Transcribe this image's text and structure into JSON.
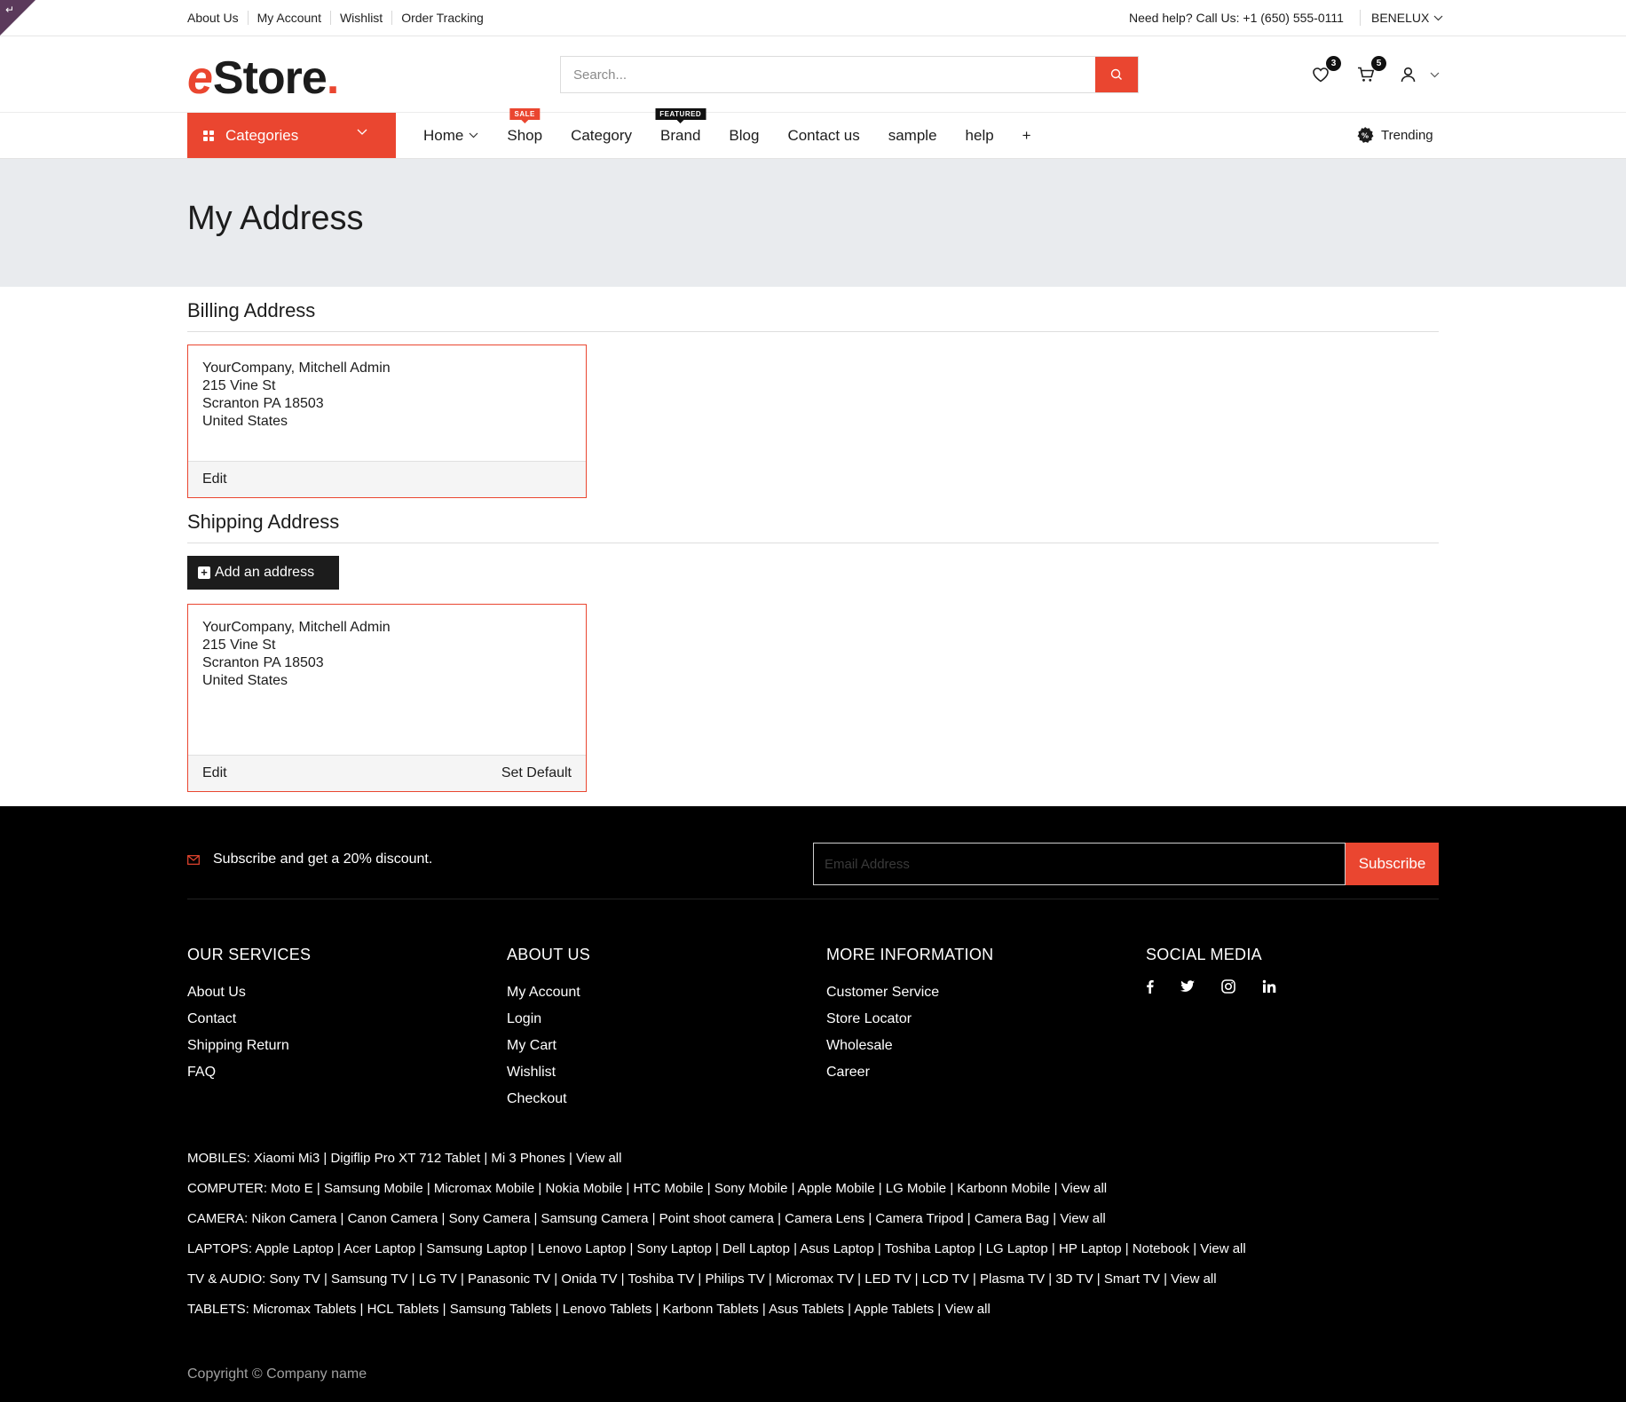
{
  "topbar": {
    "links": [
      "About Us",
      "My Account",
      "Wishlist",
      "Order Tracking"
    ],
    "help_text": "Need help? Call Us: +1 (650) 555-0111",
    "region": "BENELUX"
  },
  "header": {
    "logo_e": "e",
    "logo_rest": "Store",
    "logo_dot": ".",
    "search_placeholder": "Search...",
    "wishlist_count": "3",
    "cart_count": "5"
  },
  "nav": {
    "categories_label": "Categories",
    "items": [
      {
        "label": "Home"
      },
      {
        "label": "Shop",
        "tag": "SALE"
      },
      {
        "label": "Category"
      },
      {
        "label": "Brand",
        "tag": "FEATURED"
      },
      {
        "label": "Blog"
      },
      {
        "label": "Contact us"
      },
      {
        "label": "sample"
      },
      {
        "label": "help"
      },
      {
        "label": "+"
      }
    ],
    "trending_label": "Trending"
  },
  "page": {
    "title": "My Address",
    "billing_heading": "Billing Address",
    "shipping_heading": "Shipping Address",
    "add_address_label": "Add an address",
    "billing": {
      "lines": [
        "YourCompany, Mitchell Admin",
        "215 Vine St",
        "Scranton PA 18503",
        "United States"
      ],
      "edit_label": "Edit"
    },
    "shipping": {
      "lines": [
        "YourCompany, Mitchell Admin",
        "215 Vine St",
        "Scranton PA 18503",
        "United States"
      ],
      "edit_label": "Edit",
      "set_default_label": "Set Default"
    }
  },
  "footer": {
    "subscribe_text": "Subscribe and get a 20% discount.",
    "email_placeholder": "Email Address",
    "subscribe_button": "Subscribe",
    "columns": [
      {
        "title": "OUR SERVICES",
        "links": [
          "About Us",
          "Contact",
          "Shipping Return",
          "FAQ"
        ]
      },
      {
        "title": "ABOUT US",
        "links": [
          "My Account",
          "Login",
          "My Cart",
          "Wishlist",
          "Checkout"
        ]
      },
      {
        "title": "MORE INFORMATION",
        "links": [
          "Customer Service",
          "Store Locator",
          "Wholesale",
          "Career"
        ]
      }
    ],
    "social_title": "SOCIAL MEDIA",
    "social_icons": [
      "facebook-icon",
      "twitter-icon",
      "instagram-icon",
      "linkedin-icon"
    ],
    "category_rows": [
      {
        "label": "MOBILES:",
        "items": [
          "Xiaomi Mi3",
          "Digiflip Pro XT 712 Tablet",
          "Mi 3 Phones",
          "View all"
        ]
      },
      {
        "label": "COMPUTER:",
        "items": [
          "Moto E",
          "Samsung Mobile",
          "Micromax Mobile",
          "Nokia Mobile",
          "HTC Mobile",
          "Sony Mobile",
          "Apple Mobile",
          "LG Mobile",
          "Karbonn Mobile",
          "View all"
        ]
      },
      {
        "label": "CAMERA:",
        "items": [
          "Nikon Camera",
          "Canon Camera",
          "Sony Camera",
          "Samsung Camera",
          "Point shoot camera",
          "Camera Lens",
          "Camera Tripod",
          "Camera Bag",
          "View all"
        ]
      },
      {
        "label": "LAPTOPS:",
        "items": [
          "Apple Laptop",
          "Acer Laptop",
          "Samsung Laptop",
          "Lenovo Laptop",
          "Sony Laptop",
          "Dell Laptop",
          "Asus Laptop",
          "Toshiba Laptop",
          "LG Laptop",
          "HP Laptop",
          "Notebook",
          "View all"
        ]
      },
      {
        "label": "TV & AUDIO:",
        "items": [
          "Sony TV",
          "Samsung TV",
          "LG TV",
          "Panasonic TV",
          "Onida TV",
          "Toshiba TV",
          "Philips TV",
          "Micromax TV",
          "LED TV",
          "LCD TV",
          "Plasma TV",
          "3D TV",
          "Smart TV",
          "View all"
        ]
      },
      {
        "label": "TABLETS:",
        "items": [
          "Micromax Tablets",
          "HCL Tablets",
          "Samsung Tablets",
          "Lenovo Tablets",
          "Karbonn Tablets",
          "Asus Tablets",
          "Apple Tablets",
          "View all"
        ]
      }
    ],
    "copyright": "Copyright © Company name"
  },
  "colors": {
    "accent": "#ea4630",
    "dark": "#1c1c1c",
    "band": "#e9ebee",
    "footer_bg": "#000000"
  }
}
